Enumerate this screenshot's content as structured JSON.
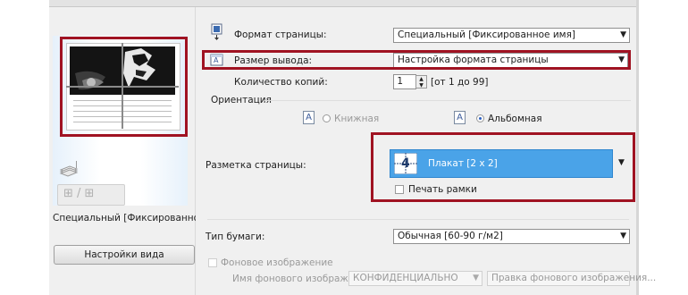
{
  "preview": {
    "caption": "Специальный [Фиксированное им",
    "view_settings_button": "Настройки вида",
    "mini_button_glyphs": "⊞ / ⊞"
  },
  "form": {
    "page_format": {
      "label": "Формат страницы:",
      "value": "Специальный [Фиксированное имя]"
    },
    "output_size": {
      "label": "Размер вывода:",
      "value": "Настройка формата страницы"
    },
    "copies": {
      "label": "Количество копий:",
      "value": "1",
      "range": "[от 1 до 99]"
    },
    "orientation": {
      "label": "Ориентация",
      "portrait": "Книжная",
      "landscape": "Альбомная",
      "selected": "landscape",
      "icon_glyph": "A"
    },
    "page_layout": {
      "label": "Разметка страницы:",
      "value": "Плакат [2 x 2]",
      "icon_number": "4",
      "print_frame_label": "Печать рамки",
      "print_frame_checked": false
    },
    "paper_type": {
      "label": "Тип бумаги:",
      "value": "Обычная [60-90 г/м2]"
    },
    "background": {
      "checkbox_label": "Фоновое изображение",
      "name_label": "Имя фонового изображения:",
      "name_value": "КОНФИДЕНЦИАЛЬНО",
      "edit_button": "Правка фонового изображения...",
      "enabled": false
    }
  },
  "colors": {
    "highlight_red": "#a01322",
    "selected_blue": "#4aa3e8",
    "dialog_bg": "#f0f0f0"
  },
  "icons": {
    "page_format": "page-format-icon",
    "output_size": "output-size-icon",
    "orientation_portrait": "portrait-orientation-icon",
    "orientation_landscape": "landscape-orientation-icon",
    "layout": "poster-layout-icon",
    "dropdown": "chevron-down-icon"
  }
}
